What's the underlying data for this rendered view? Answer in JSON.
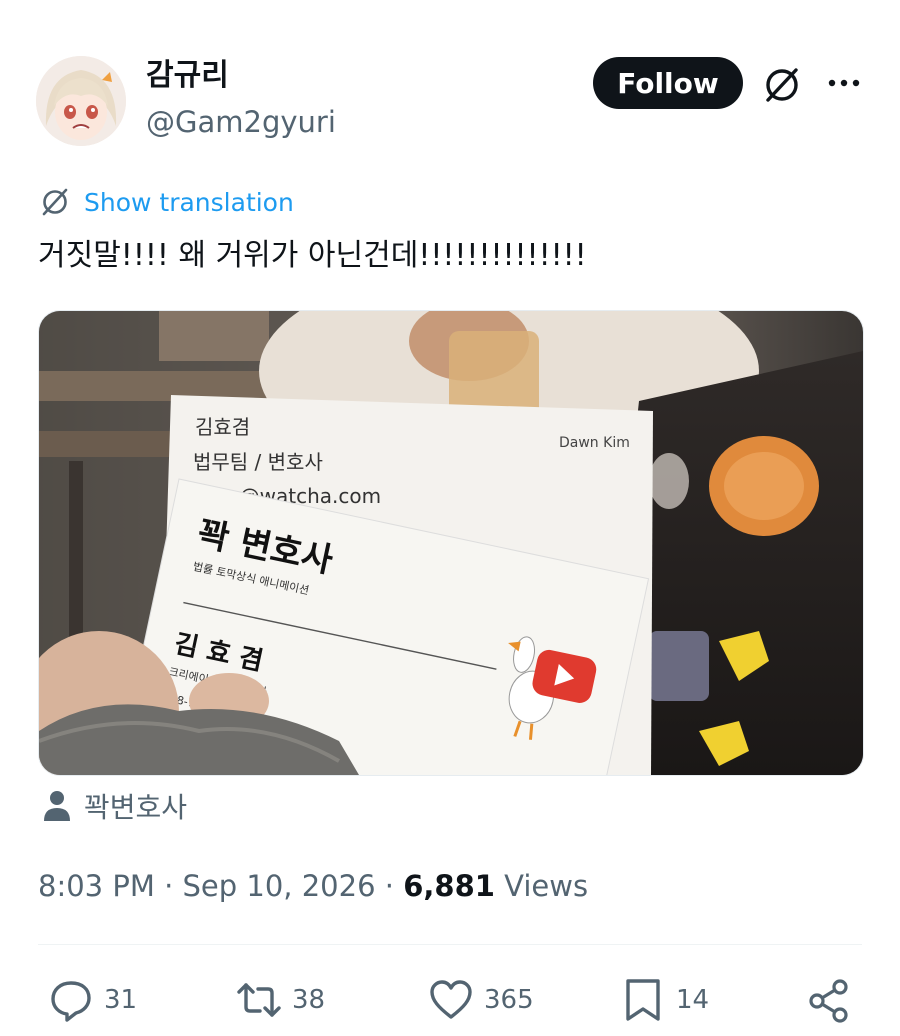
{
  "author": {
    "display_name": "감규리",
    "handle": "@Gam2gyuri",
    "avatar_icon": "anime-avatar"
  },
  "header": {
    "follow_label": "Follow",
    "grok_icon": "grok-icon",
    "more_icon": "more-icon"
  },
  "tweet": {
    "translate_label": "Show translation",
    "text": "거짓말!!!! 왜 거위가 아닌건데!!!!!!!!!!!!!!"
  },
  "media": {
    "card_back": {
      "name": "김효겸",
      "title": "법무팀 / 변호사",
      "email": "n@watcha.com",
      "english_name": "Dawn Kim"
    },
    "card_front": {
      "title": "꽉 변호사",
      "subtitle": "법률 토막상식 애니메이션",
      "name": "김 효 겸",
      "line1": "크리에이",
      "line1b": "사",
      "line2": "818-7"
    }
  },
  "tag": {
    "icon": "person-icon",
    "label": "꽉변호사"
  },
  "meta": {
    "time": "8:03 PM",
    "sep1": " · ",
    "date": "Sep 10, 2026",
    "sep2": " · ",
    "views_count": "6,881",
    "views_label": " Views"
  },
  "actions": {
    "replies": "31",
    "reposts": "38",
    "likes": "365",
    "bookmarks": "14"
  },
  "colors": {
    "accent": "#1d9bf0",
    "text": "#0f1419",
    "secondary": "#536471"
  }
}
